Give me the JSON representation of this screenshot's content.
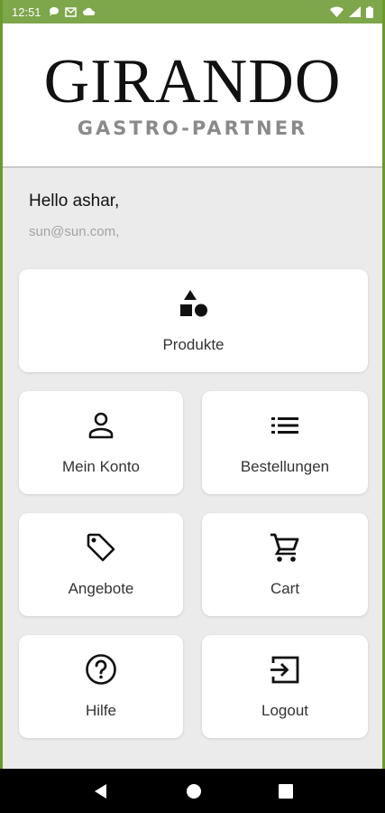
{
  "status_bar": {
    "time": "12:51",
    "left_icons": [
      "chat-bubble-icon",
      "gmail-icon",
      "cloud-icon"
    ],
    "right_icons": [
      "wifi-icon",
      "signal-icon",
      "battery-icon"
    ]
  },
  "header": {
    "brand_name": "GIRANDO",
    "brand_subtitle": "GASTRO-PARTNER"
  },
  "greeting": {
    "hello": "Hello ashar,",
    "email": "sun@sun.com,"
  },
  "menu": {
    "produkte": {
      "label": "Produkte",
      "icon": "shapes-icon"
    },
    "mein_konto": {
      "label": "Mein Konto",
      "icon": "person-icon"
    },
    "bestellungen": {
      "label": "Bestellungen",
      "icon": "list-icon"
    },
    "angebote": {
      "label": "Angebote",
      "icon": "tag-icon"
    },
    "cart": {
      "label": "Cart",
      "icon": "cart-icon"
    },
    "hilfe": {
      "label": "Hilfe",
      "icon": "help-icon"
    },
    "logout": {
      "label": "Logout",
      "icon": "logout-icon"
    }
  },
  "colors": {
    "status_bar": "#7ea64a",
    "background": "#ebebeb",
    "card": "#ffffff",
    "nav_bar": "#000000"
  }
}
